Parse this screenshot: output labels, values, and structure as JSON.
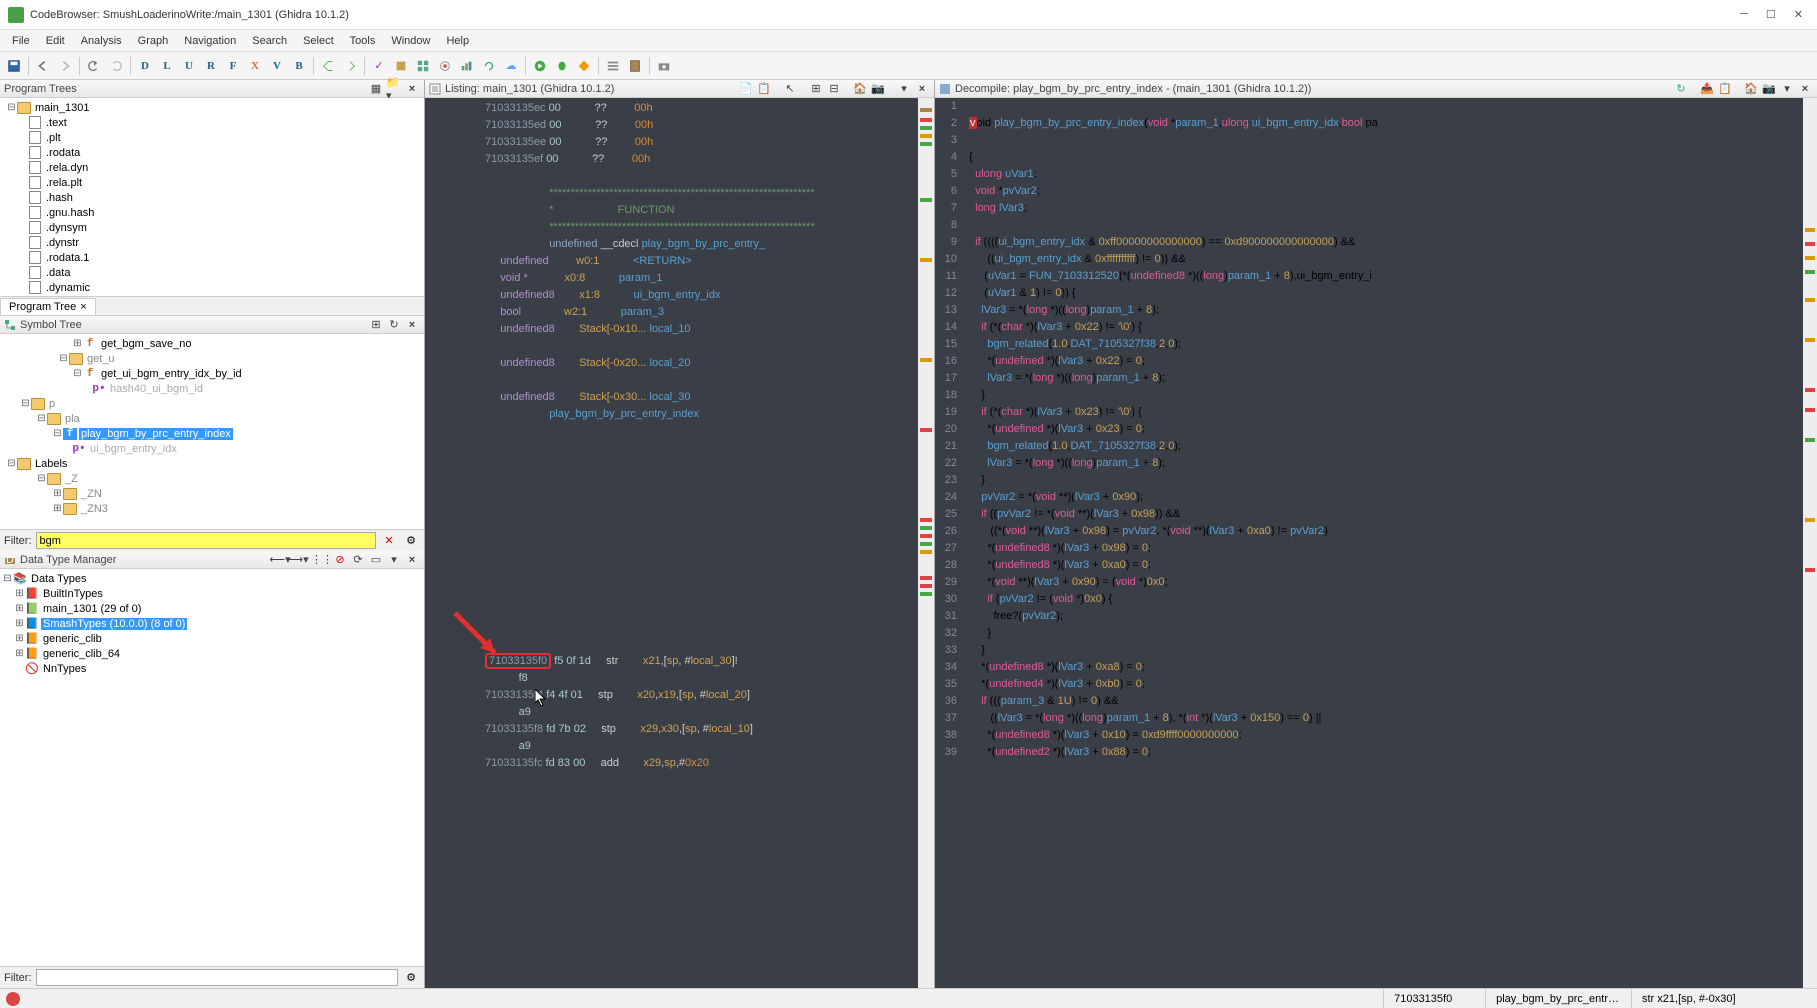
{
  "window": {
    "title": "CodeBrowser: SmushLoaderinoWrite:/main_1301 (Ghidra 10.1.2)"
  },
  "menubar": [
    "File",
    "Edit",
    "Analysis",
    "Graph",
    "Navigation",
    "Search",
    "Select",
    "Tools",
    "Window",
    "Help"
  ],
  "program_trees": {
    "title": "Program Trees",
    "tab": "Program Tree",
    "root": "main_1301",
    "items": [
      ".text",
      ".plt",
      ".rodata",
      ".rela.dyn",
      ".rela.plt",
      ".hash",
      ".gnu.hash",
      ".dynsym",
      ".dynstr",
      ".rodata.1",
      ".data",
      ".dynamic"
    ]
  },
  "symbol_tree": {
    "title": "Symbol Tree",
    "nodes": {
      "get_bgm_save_no": "get_bgm_save_no",
      "get_u": "get_u",
      "get_ui": "get_ui_bgm_entry_idx_by_id",
      "hash40": "hash40_ui_bgm_id",
      "p": "p",
      "pla": "pla",
      "play": "play_bgm_by_prc_entry_index",
      "ui_bgm": "ui_bgm_entry_idx",
      "labels": "Labels",
      "z": "_Z",
      "zn": "_ZN",
      "zn3": "_ZN3"
    },
    "filter_label": "Filter:",
    "filter_value": "bgm"
  },
  "data_type_manager": {
    "title": "Data Type Manager",
    "root": "Data Types",
    "items": [
      {
        "label": "BuiltInTypes"
      },
      {
        "label": "main_1301 (29 of 0)"
      },
      {
        "label": "SmashTypes (10.0.0) (8 of 0)",
        "selected": true
      },
      {
        "label": "generic_clib"
      },
      {
        "label": "generic_clib_64"
      },
      {
        "label": "NnTypes"
      }
    ],
    "filter_label": "Filter:",
    "filter_value": ""
  },
  "listing": {
    "title": "Listing: main_1301 (Ghidra 10.1.2)",
    "pre_lines": [
      {
        "addr": "71033135ec",
        "bytes": "00",
        "q": "??",
        "val": "00h"
      },
      {
        "addr": "71033135ed",
        "bytes": "00",
        "q": "??",
        "val": "00h"
      },
      {
        "addr": "71033135ee",
        "bytes": "00",
        "q": "??",
        "val": "00h"
      },
      {
        "addr": "71033135ef",
        "bytes": "00",
        "q": "??",
        "val": "00h"
      }
    ],
    "function_header": {
      "stars": "**************************************************************",
      "star": "*",
      "func_label": "FUNCTION",
      "signature": "undefined __cdecl play_bgm_by_prc_entry_",
      "rows": [
        {
          "t": "undefined",
          "r": "w0:1",
          "n": "<RETURN>"
        },
        {
          "t": "void *",
          "r": "x0:8",
          "n": "param_1"
        },
        {
          "t": "undefined8",
          "r": "x1:8",
          "n": "ui_bgm_entry_idx"
        },
        {
          "t": "bool",
          "r": "w2:1",
          "n": "param_3"
        },
        {
          "t": "undefined8",
          "r": "Stack[-0x10...",
          "n": "local_10"
        },
        {
          "t": "",
          "r": "",
          "n": ""
        },
        {
          "t": "undefined8",
          "r": "Stack[-0x20...",
          "n": "local_20"
        },
        {
          "t": "",
          "r": "",
          "n": ""
        },
        {
          "t": "undefined8",
          "r": "Stack[-0x30...",
          "n": "local_30"
        }
      ],
      "name": "play_bgm_by_prc_entry_index"
    },
    "body": [
      {
        "addr": "71033135f0",
        "bytes": "f5 0f 1d",
        "mn": "str",
        "ops": "x21,[sp, #local_30]!",
        "hl": true,
        "wrap": "f8"
      },
      {
        "addr": "71033135f4",
        "bytes": "f4 4f 01",
        "mn": "stp",
        "ops": "x20,x19,[sp, #local_20]",
        "wrap": "a9"
      },
      {
        "addr": "71033135f8",
        "bytes": "fd 7b 02",
        "mn": "stp",
        "ops": "x29,x30,[sp, #local_10]",
        "wrap": "a9"
      },
      {
        "addr": "71033135fc",
        "bytes": "fd 83 00",
        "mn": "add",
        "ops": "x29,sp,#0x20"
      }
    ]
  },
  "decompile": {
    "title": "Decompile: play_bgm_by_prc_entry_index - (main_1301 (Ghidra 10.1.2))",
    "lines": [
      {
        "n": 1,
        "t": ""
      },
      {
        "n": 2,
        "t": "void play_bgm_by_prc_entry_index(void *param_1,ulong ui_bgm_entry_idx,bool pa",
        "sig": true
      },
      {
        "n": 3,
        "t": ""
      },
      {
        "n": 4,
        "t": "{"
      },
      {
        "n": 5,
        "t": "  ulong uVar1;"
      },
      {
        "n": 6,
        "t": "  void *pvVar2;"
      },
      {
        "n": 7,
        "t": "  long lVar3;"
      },
      {
        "n": 8,
        "t": ""
      },
      {
        "n": 9,
        "t": "  if ((((ui_bgm_entry_idx & 0xff00000000000000) == 0xd900000000000000) &&"
      },
      {
        "n": 10,
        "t": "      ((ui_bgm_entry_idx & 0xffffffffff) != 0)) &&"
      },
      {
        "n": 11,
        "t": "     (uVar1 = FUN_7103312520(*(undefined8 *)((long)param_1 + 8),ui_bgm_entry_i"
      },
      {
        "n": 12,
        "t": "     (uVar1 & 1) != 0)) {"
      },
      {
        "n": 13,
        "t": "    lVar3 = *(long *)((long)param_1 + 8);"
      },
      {
        "n": 14,
        "t": "    if (*(char *)(lVar3 + 0x22) != '\\0') {"
      },
      {
        "n": 15,
        "t": "      bgm_related(1.0,DAT_7105327f38,2,0);"
      },
      {
        "n": 16,
        "t": "      *(undefined *)(lVar3 + 0x22) = 0;"
      },
      {
        "n": 17,
        "t": "      lVar3 = *(long *)((long)param_1 + 8);"
      },
      {
        "n": 18,
        "t": "    }"
      },
      {
        "n": 19,
        "t": "    if (*(char *)(lVar3 + 0x23) != '\\0') {"
      },
      {
        "n": 20,
        "t": "      *(undefined *)(lVar3 + 0x23) = 0;"
      },
      {
        "n": 21,
        "t": "      bgm_related(1.0,DAT_7105327f38,2,0);"
      },
      {
        "n": 22,
        "t": "      lVar3 = *(long *)((long)param_1 + 8);"
      },
      {
        "n": 23,
        "t": "    }"
      },
      {
        "n": 24,
        "t": "    pvVar2 = *(void **)(lVar3 + 0x90);"
      },
      {
        "n": 25,
        "t": "    if ((pvVar2 != *(void **)(lVar3 + 0x98)) &&"
      },
      {
        "n": 26,
        "t": "       ((*(void **)(lVar3 + 0x98) = pvVar2, *(void **)(lVar3 + 0xa0) != pvVar2)"
      },
      {
        "n": 27,
        "t": "      *(undefined8 *)(lVar3 + 0x98) = 0;"
      },
      {
        "n": 28,
        "t": "      *(undefined8 *)(lVar3 + 0xa0) = 0;"
      },
      {
        "n": 29,
        "t": "      *(void **)(lVar3 + 0x90) = (void *)0x0;"
      },
      {
        "n": 30,
        "t": "      if (pvVar2 != (void *)0x0) {"
      },
      {
        "n": 31,
        "t": "        free?(pvVar2);"
      },
      {
        "n": 32,
        "t": "      }"
      },
      {
        "n": 33,
        "t": "    }"
      },
      {
        "n": 34,
        "t": "    *(undefined8 *)(lVar3 + 0xa8) = 0;"
      },
      {
        "n": 35,
        "t": "    *(undefined4 *)(lVar3 + 0xb0) = 0;"
      },
      {
        "n": 36,
        "t": "    if (((param_3 & 1U) != 0) &&"
      },
      {
        "n": 37,
        "t": "       ((lVar3 = *(long *)((long)param_1 + 8), *(int *)(lVar3 + 0x150) == 0) ||"
      },
      {
        "n": 38,
        "t": "      *(undefined8 *)(lVar3 + 0x10) = 0xd9ffff0000000000;"
      },
      {
        "n": 39,
        "t": "      *(undefined2 *)(lVar3 + 0x88) = 0;"
      }
    ]
  },
  "statusbar": {
    "addr": "71033135f0",
    "func": "play_bgm_by_prc_entr…",
    "loc": "str x21,[sp, #-0x30]"
  }
}
